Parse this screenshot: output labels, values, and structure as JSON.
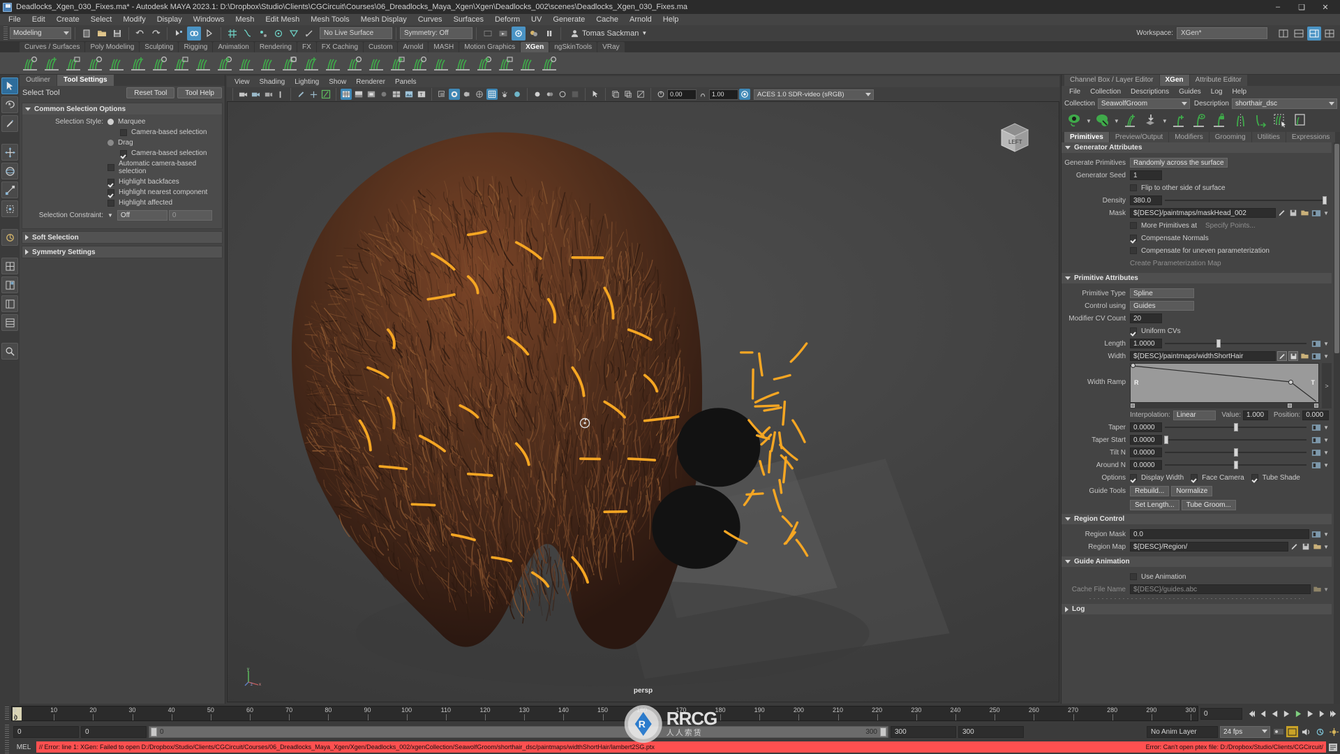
{
  "titlebar": {
    "title": "Deadlocks_Xgen_030_Fixes.ma* - Autodesk MAYA 2023.1: D:\\Dropbox\\Studio\\Clients\\CGCircuit\\Courses\\06_Dreadlocks_Maya_Xgen\\Xgen\\Deadlocks_002\\scenes\\Deadlocks_Xgen_030_Fixes.ma",
    "minimize": "–",
    "maximize": "❑",
    "close": "✕"
  },
  "menubar": {
    "items": [
      "File",
      "Edit",
      "Create",
      "Select",
      "Modify",
      "Display",
      "Windows",
      "Mesh",
      "Edit Mesh",
      "Mesh Tools",
      "Mesh Display",
      "Curves",
      "Surfaces",
      "Deform",
      "UV",
      "Generate",
      "Cache",
      "Arnold",
      "Help"
    ]
  },
  "statusbar": {
    "mode": "Modeling",
    "live_surface": "No Live Surface",
    "symmetry": "Symmetry: Off",
    "user": "Tomas Sackman",
    "workspace_label": "Workspace:",
    "workspace_value": "XGen*"
  },
  "shelf": {
    "tabs": [
      "Curves / Surfaces",
      "Poly Modeling",
      "Sculpting",
      "Rigging",
      "Animation",
      "Rendering",
      "FX",
      "FX Caching",
      "Custom",
      "Arnold",
      "MASH",
      "Motion Graphics",
      "XGen",
      "ngSkinTools",
      "VRay"
    ],
    "selected": "XGen"
  },
  "toolsettings": {
    "tabs": [
      "Outliner",
      "Tool Settings"
    ],
    "selected_tab": "Tool Settings",
    "tool_name": "Select Tool",
    "reset_label": "Reset Tool",
    "help_label": "Tool Help",
    "groups": [
      {
        "title": "Common Selection Options",
        "open": true
      },
      {
        "title": "Soft Selection",
        "open": false
      },
      {
        "title": "Symmetry Settings",
        "open": false
      }
    ],
    "selection_style_label": "Selection Style:",
    "marquee": "Marquee",
    "marquee_cam": "Camera-based selection",
    "drag": "Drag",
    "drag_cam": "Camera-based selection",
    "auto_cam": "Automatic camera-based selection",
    "hl_backfaces": "Highlight backfaces",
    "hl_nearest": "Highlight nearest component",
    "hl_affected": "Highlight affected",
    "constraint_label": "Selection Constraint:",
    "constraint_value": "Off",
    "constraint_num": "0"
  },
  "viewport": {
    "menus": [
      "View",
      "Shading",
      "Lighting",
      "Show",
      "Renderer",
      "Panels"
    ],
    "exposure": "0.00",
    "gamma": "1.00",
    "colorspace": "ACES 1.0 SDR-video (sRGB)",
    "camera_label": "persp",
    "viewcube_label": "LEFT",
    "axis_x": "x",
    "axis_y": "y",
    "axis_z": "z"
  },
  "xgen": {
    "panel_tabs": [
      "Channel Box / Layer Editor",
      "XGen",
      "Attribute Editor"
    ],
    "panel_tab_selected": "XGen",
    "menu": [
      "File",
      "Collection",
      "Descriptions",
      "Guides",
      "Log",
      "Help"
    ],
    "collection_label": "Collection",
    "collection_value": "SeawolfGroom",
    "description_label": "Description",
    "description_value": "shorthair_dsc",
    "tabs": [
      "Primitives",
      "Preview/Output",
      "Modifiers",
      "Grooming",
      "Utilities",
      "Expressions"
    ],
    "tab_selected": "Primitives",
    "sections": {
      "generator": {
        "title": "Generator Attributes",
        "generate_primitives_label": "Generate Primitives",
        "generate_primitives_value": "Randomly across the surface",
        "generator_seed_label": "Generator Seed",
        "generator_seed_value": "1",
        "flip_label": "Flip to other side of surface",
        "flip_checked": false,
        "density_label": "Density",
        "density_value": "380.0",
        "density_pct": 99,
        "mask_label": "Mask",
        "mask_value": "${DESC}/paintmaps/maskHead_002",
        "more_prims_label": "More Primitives at",
        "more_prims_checked": false,
        "specify_points": "Specify Points...",
        "compensate_normals_label": "Compensate Normals",
        "compensate_normals_checked": true,
        "compensate_uneven_label": "Compensate for uneven parameterization",
        "compensate_uneven_checked": false,
        "create_param_map": "Create Parameterization Map"
      },
      "primitive": {
        "title": "Primitive Attributes",
        "primitive_type_label": "Primitive Type",
        "primitive_type_value": "Spline",
        "control_using_label": "Control using",
        "control_using_value": "Guides",
        "cv_count_label": "Modifier CV Count",
        "cv_count_value": "20",
        "uniform_cvs_label": "Uniform CVs",
        "uniform_cvs_checked": true,
        "length_label": "Length",
        "length_value": "1.0000",
        "length_pct": 38,
        "width_label": "Width",
        "width_value": "${DESC}/paintmaps/widthShortHair",
        "width_ramp_label": "Width Ramp",
        "ramp_r": "R",
        "ramp_t": "T",
        "interpolation_label": "Interpolation:",
        "interpolation_value": "Linear",
        "value_label": "Value:",
        "value_value": "1.000",
        "position_label": "Position:",
        "position_value": "0.000",
        "taper_label": "Taper",
        "taper_value": "0.0000",
        "taper_pct": 50,
        "taper_start_label": "Taper Start",
        "taper_start_value": "0.0000",
        "taper_start_pct": 1,
        "tilt_label": "Tilt N",
        "tilt_value": "0.0000",
        "tilt_pct": 50,
        "around_label": "Around N",
        "around_value": "0.0000",
        "around_pct": 50,
        "options_label": "Options",
        "display_width_label": "Display Width",
        "display_width_checked": true,
        "face_camera_label": "Face Camera",
        "face_camera_checked": true,
        "tube_shade_label": "Tube Shade",
        "tube_shade_checked": true,
        "guide_tools_label": "Guide Tools",
        "btn_rebuild": "Rebuild...",
        "btn_normalize": "Normalize",
        "btn_set_length": "Set Length...",
        "btn_tube_groom": "Tube Groom..."
      },
      "region": {
        "title": "Region Control",
        "region_mask_label": "Region Mask",
        "region_mask_value": "0.0",
        "region_map_label": "Region Map",
        "region_map_value": "${DESC}/Region/"
      },
      "guideanim": {
        "title": "Guide Animation",
        "use_animation_label": "Use Animation",
        "use_animation_checked": false,
        "cache_file_label": "Cache File Name",
        "cache_file_value": "${DESC}/guides.abc"
      },
      "log": {
        "title": "Log"
      }
    }
  },
  "timeline": {
    "ticks": [
      0,
      10,
      20,
      30,
      40,
      50,
      60,
      70,
      80,
      90,
      100,
      110,
      120,
      130,
      140,
      150,
      160,
      170,
      180,
      190,
      200,
      210,
      220,
      230,
      240,
      250,
      260,
      270,
      280,
      290,
      300
    ],
    "current_frame": "0",
    "frame_field": "0",
    "range_start": "0",
    "range_start2": "0",
    "slider_min": "0",
    "slider_max": "300",
    "range_end": "300",
    "range_end2": "300",
    "anim_layer": "No Anim Layer",
    "fps": "24 fps"
  },
  "command": {
    "mel_label": "MEL",
    "error_left": "// Error: line 1: XGen: Failed to open D:/Dropbox/Studio/Clients/CGCircuit/Courses/06_Dreadlocks_Maya_Xgen/Xgen/Deadlocks_002/xgenCollection/SeawolfGroom/shorthair_dsc/paintmaps/widthShortHair/lambert2SG.ptx",
    "error_right": "Error: Can't open ptex file: D:/Dropbox/Studio/Clients/CGCircuit/"
  },
  "colors": {
    "accent_blue": "#4a93c4",
    "xgen_green": "#3faa4a",
    "hair_brown": "#4a2a1c",
    "guide_orange": "#f5a623",
    "error_red": "#ff5050",
    "timeline_tan": "#cfc79a"
  }
}
